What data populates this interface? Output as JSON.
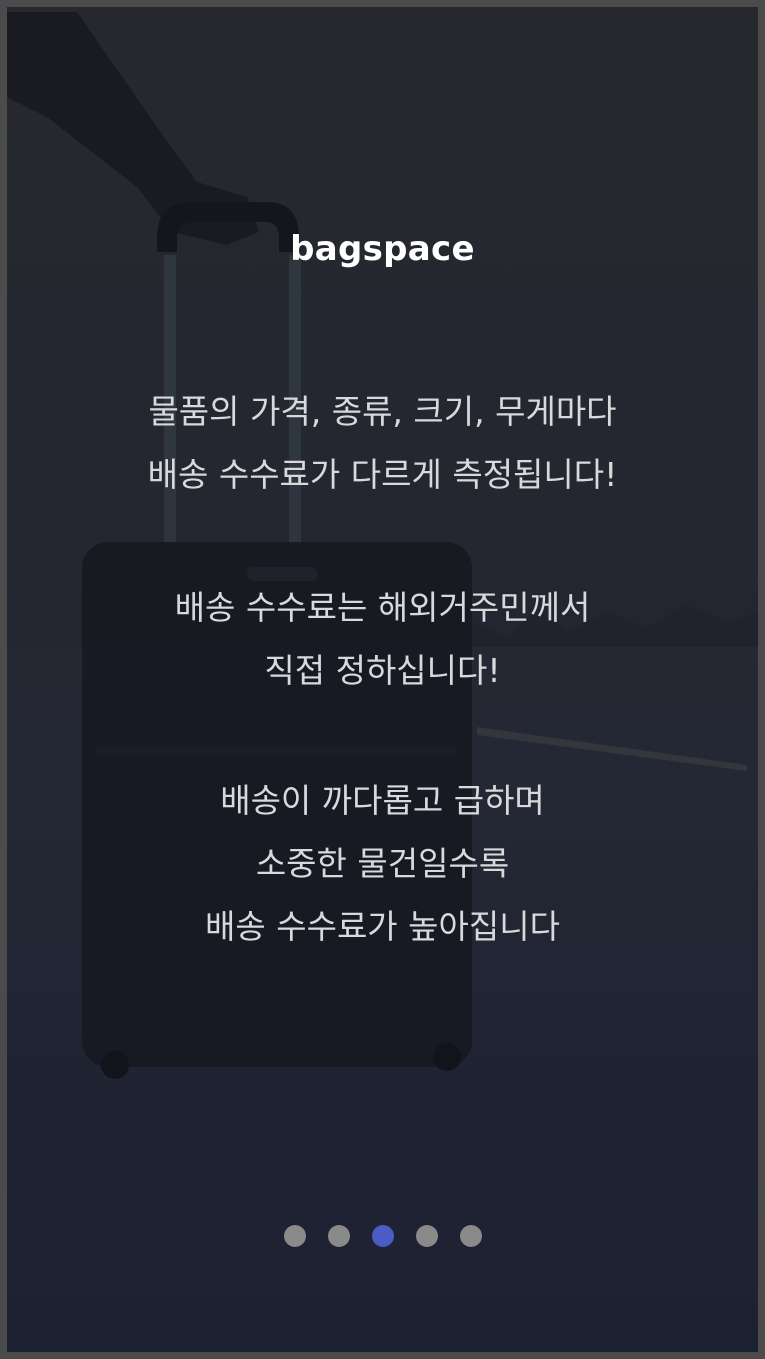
{
  "app": {
    "title": "bagspace"
  },
  "intro": {
    "paragraphs": [
      [
        "물품의 가격, 종류, 크기, 무게마다",
        "배송 수수료가 다르게 측정됩니다!"
      ],
      [
        "배송 수수료는 해외거주민께서",
        "직접 정하십니다!"
      ],
      [
        "배송이 까다롭고 급하며",
        "소중한 물건일수록",
        "배송 수수료가 높아집니다"
      ]
    ]
  },
  "pager": {
    "total": 5,
    "active_index": 2,
    "colors": {
      "inactive": "#8a8a8a",
      "active": "#4b5cc4"
    }
  },
  "background": {
    "icon": "luggage-photo"
  }
}
